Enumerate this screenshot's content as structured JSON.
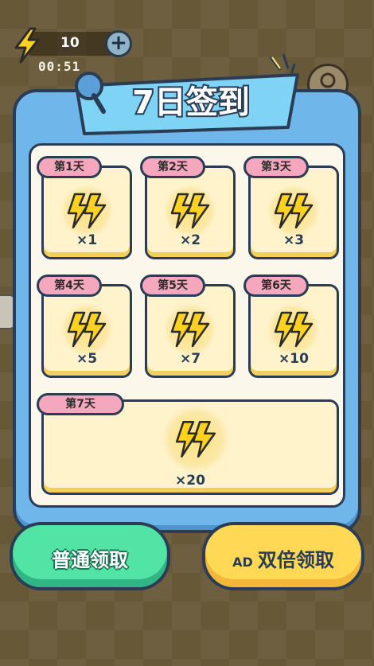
{
  "hud": {
    "energy_count": "10",
    "timer": "00:51",
    "add_label": "+"
  },
  "title": "7日签到",
  "days": [
    {
      "label": "第1天",
      "qty": "×1"
    },
    {
      "label": "第2天",
      "qty": "×2"
    },
    {
      "label": "第3天",
      "qty": "×3"
    },
    {
      "label": "第4天",
      "qty": "×5"
    },
    {
      "label": "第5天",
      "qty": "×7"
    },
    {
      "label": "第6天",
      "qty": "×10"
    },
    {
      "label": "第7天",
      "qty": "×20"
    }
  ],
  "buttons": {
    "normal": "普通领取",
    "double_ad": "AD",
    "double": "双倍领取"
  },
  "colors": {
    "panel": "#6fb6ea",
    "tag": "#f4a7bd",
    "card": "#fff3cc",
    "green_button": "#52e4a4",
    "yellow_button": "#ffd955",
    "bolt": "#ffd21f"
  },
  "icons": {
    "energy": "lightning-bolt-icon",
    "add": "plus-icon",
    "reward": "lightning-bolt-icon",
    "pin": "pushpin-icon",
    "avatar": "avatar-icon"
  }
}
